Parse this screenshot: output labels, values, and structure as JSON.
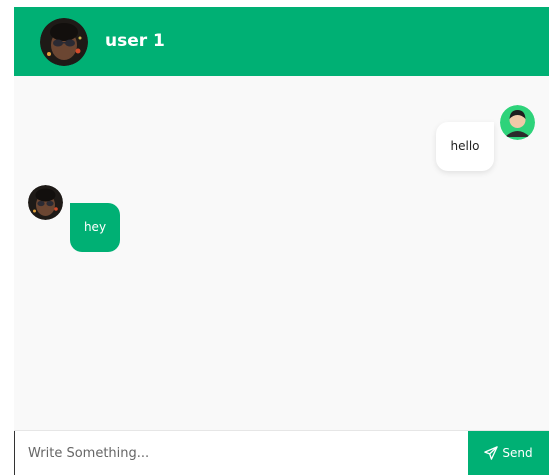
{
  "header": {
    "title": "user 1",
    "avatar_icon": "user-photo-avatar"
  },
  "messages": [
    {
      "direction": "sent",
      "text": "hello",
      "avatar_icon": "user-silhouette-avatar"
    },
    {
      "direction": "received",
      "text": "hey",
      "avatar_icon": "user-photo-avatar"
    }
  ],
  "composer": {
    "placeholder": "Write Something...",
    "send_label": "Send",
    "send_icon": "paper-plane-icon"
  },
  "colors": {
    "accent": "#00b074",
    "background": "#f9f9f9",
    "bubble_sent": "#ffffff",
    "bubble_received": "#00b074"
  }
}
